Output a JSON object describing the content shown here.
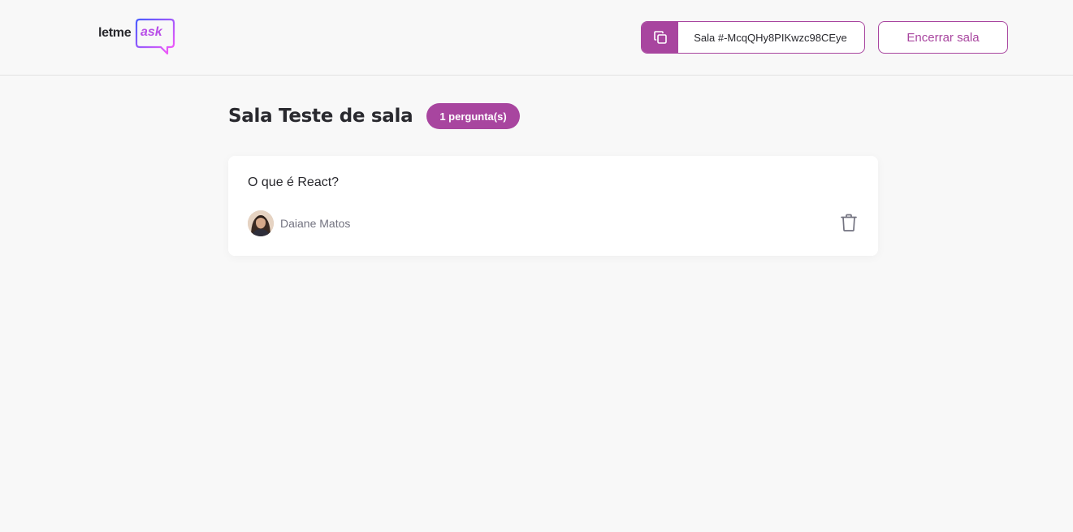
{
  "header": {
    "logo": {
      "word1": "letme",
      "word2": "ask"
    },
    "room_code": {
      "label": "Sala #-McqQHy8PIKwzc98CEye"
    },
    "close_room_label": "Encerrar sala"
  },
  "main": {
    "title": "Sala Teste de sala",
    "question_count_badge": "1 pergunta(s)",
    "questions": [
      {
        "content": "O que é React?",
        "author": "Daiane Matos",
        "actions": [
          "delete-icon"
        ]
      }
    ]
  },
  "colors": {
    "accent": "#a8459f",
    "logo_gradient_start": "#485bff",
    "logo_gradient_end": "#ff59f8",
    "background": "#f8f8f8",
    "text": "#29292e",
    "muted_text": "#737380"
  }
}
